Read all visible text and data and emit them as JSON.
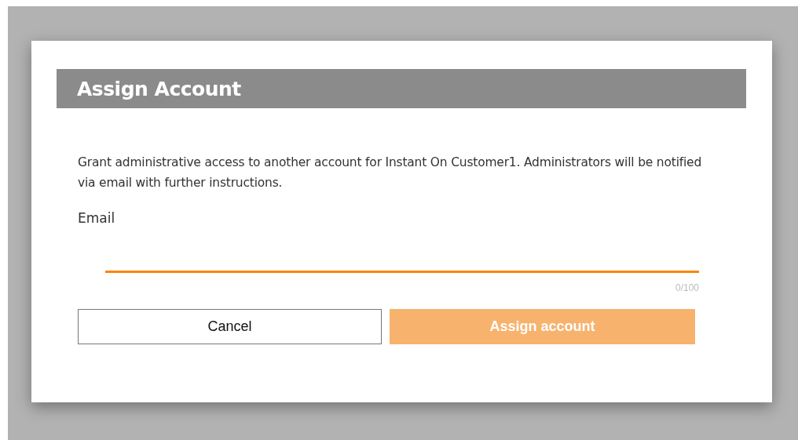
{
  "dialog": {
    "title": "Assign Account",
    "description": "Grant administrative access to another account for Instant On Customer1. Administrators will be notified via email with further instructions.",
    "email": {
      "label": "Email",
      "counter": "0/100"
    },
    "buttons": [
      {
        "label": "Cancel",
        "kind": "secondary",
        "disabled": false
      },
      {
        "label": "Assign account",
        "kind": "primary",
        "disabled": true
      }
    ]
  }
}
